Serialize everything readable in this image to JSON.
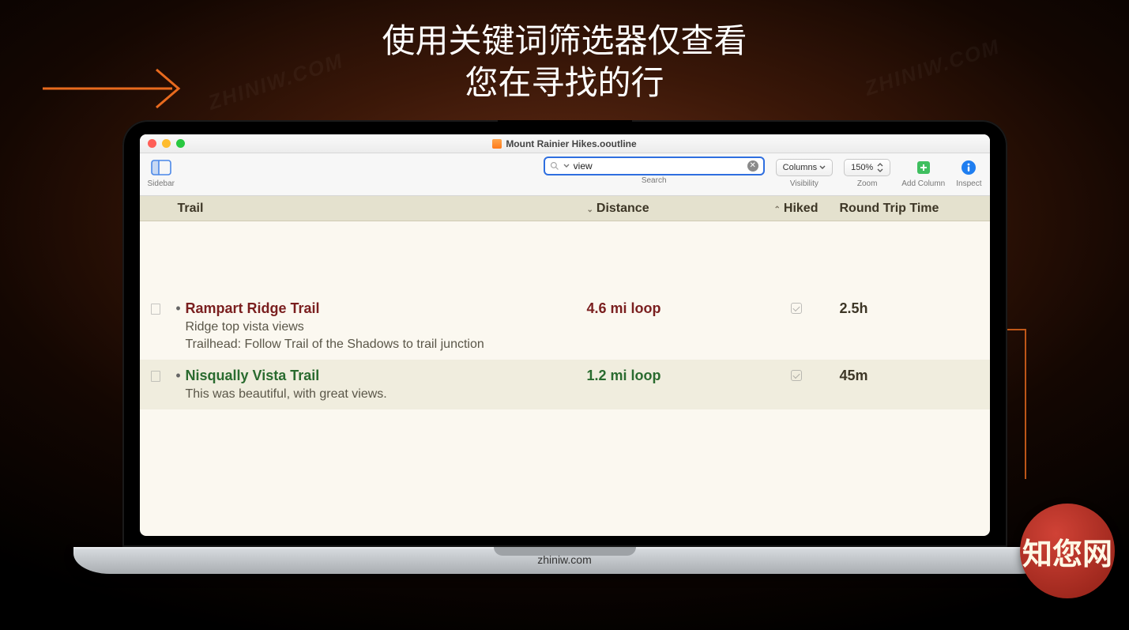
{
  "headline": {
    "line1": "使用关键词筛选器仅查看",
    "line2": "您在寻找的行"
  },
  "watermark": "ZHINIW.COM",
  "footer_url": "zhiniw.com",
  "badge_text": "知您网",
  "app": {
    "doc_title": "Mount Rainier Hikes.ooutline",
    "toolbar": {
      "sidebar_label": "Sidebar",
      "search_label": "Search",
      "search_value": "view",
      "visibility_btn": "Columns",
      "visibility_label": "Visibility",
      "zoom_value": "150%",
      "zoom_label": "Zoom",
      "add_column_label": "Add Column",
      "inspect_label": "Inspect"
    },
    "columns": {
      "trail": "Trail",
      "distance": "Distance",
      "hiked": "Hiked",
      "round_trip": "Round Trip Time"
    },
    "rows": [
      {
        "title": "Rampart Ridge Trail",
        "sub1": "Ridge top vista views",
        "sub2": "Trailhead: Follow Trail of the Shadows to trail junction",
        "distance": "4.6 mi loop",
        "hiked": true,
        "time": "2.5h"
      },
      {
        "title": "Nisqually Vista Trail",
        "sub1": "This was beautiful, with great views.",
        "sub2": "",
        "distance": "1.2 mi loop",
        "hiked": true,
        "time": "45m"
      }
    ]
  }
}
